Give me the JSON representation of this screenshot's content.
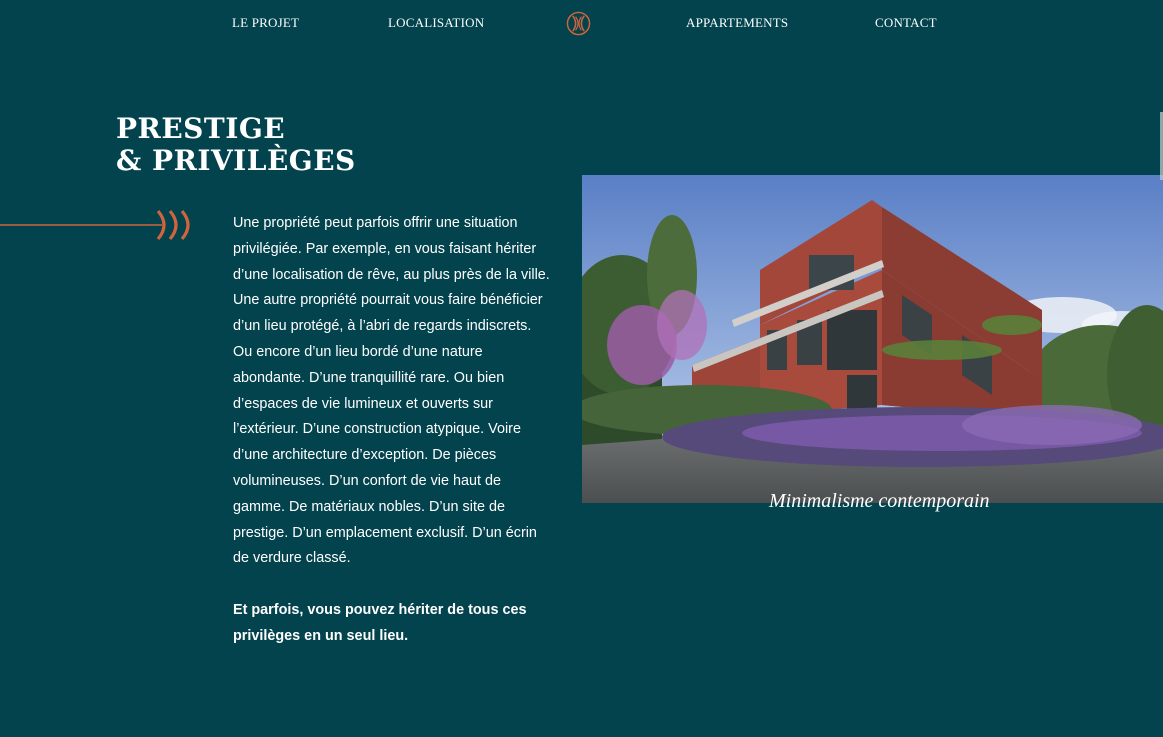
{
  "nav": {
    "items": [
      {
        "label": "LE PROJET"
      },
      {
        "label": "LOCALISATION"
      },
      {
        "label": "APPARTEMENTS"
      },
      {
        "label": "CONTACT"
      }
    ]
  },
  "colors": {
    "background": "#02434e",
    "accent": "#d0653d",
    "text": "#ffffff"
  },
  "section": {
    "title_line1": "PRESTIGE",
    "title_line2": "& PRIVILÈGES",
    "paragraph": "Une propriété peut parfois offrir une situation privilégiée. Par exemple, en vous faisant hériter d’une localisation de rêve, au plus près de la ville. Une autre propriété pourrait vous faire bénéficier d’un lieu protégé, à l’abri de regards indiscrets. Ou encore d’un lieu bordé d’une nature abondante. D’une tranquillité rare. Ou bien d’espaces de vie lumineux et ouverts sur l’extérieur. D’une construction atypique. Voire d’une architecture d’exception. De pièces volumineuses. D’un confort de vie haut de gamme. De matériaux nobles. D’un site de prestige. D’un emplacement exclusif. D’un écrin de verdure classé.",
    "closing": "Et parfois, vous pouvez hériter de tous ces privilèges en un seul lieu."
  },
  "image": {
    "caption": "Minimalisme contemporain"
  }
}
